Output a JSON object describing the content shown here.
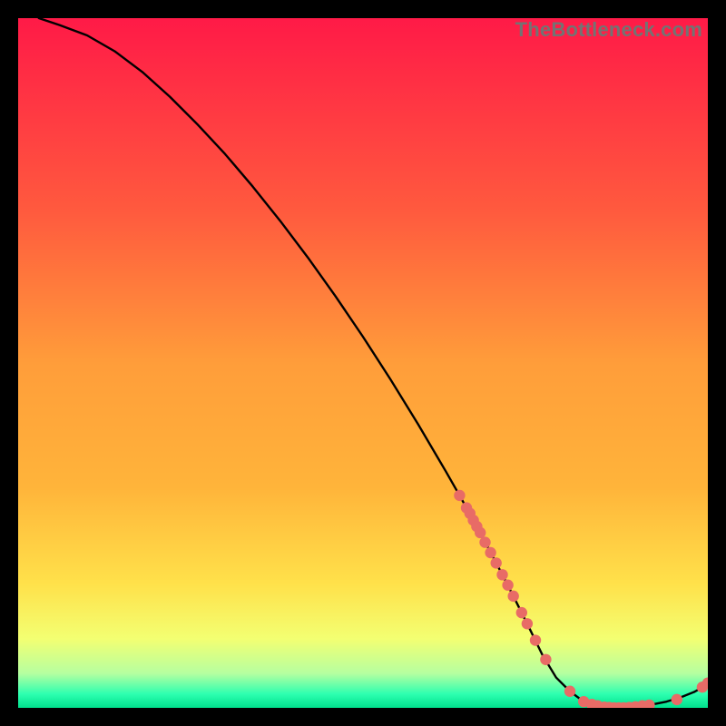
{
  "watermark": "TheBottleneck.com",
  "colors": {
    "gradient_top": "#ff1a47",
    "gradient_mid1": "#ff6a3c",
    "gradient_mid2": "#ffb43a",
    "gradient_mid3": "#ffe14a",
    "gradient_mid4": "#e7ff6a",
    "gradient_bottom_band": "#2dffb0",
    "gradient_bottom_line": "#00e08c",
    "black": "#000000",
    "line": "#000000",
    "marker": "#e86b66"
  },
  "chart_data": {
    "type": "line",
    "title": "",
    "xlabel": "",
    "ylabel": "",
    "xlim": [
      0,
      100
    ],
    "ylim": [
      0,
      100
    ],
    "series": [
      {
        "name": "curve",
        "x": [
          3,
          6,
          10,
          14,
          18,
          22,
          26,
          30,
          34,
          38,
          42,
          46,
          50,
          54,
          58,
          62,
          64,
          66,
          68,
          70,
          72,
          74,
          76,
          78,
          80,
          82,
          84,
          86,
          88,
          90,
          92,
          94,
          96,
          98,
          100
        ],
        "y": [
          100,
          99,
          97.5,
          95.2,
          92.2,
          88.6,
          84.6,
          80.3,
          75.6,
          70.6,
          65.3,
          59.7,
          53.8,
          47.6,
          41.1,
          34.3,
          30.8,
          27.2,
          23.5,
          19.7,
          15.8,
          11.8,
          7.7,
          4.4,
          2.4,
          0.9,
          0.2,
          0,
          0,
          0.2,
          0.5,
          0.9,
          1.5,
          2.3,
          3.4
        ]
      }
    ],
    "markers": [
      {
        "x": 64,
        "y": 30.8
      },
      {
        "x": 65,
        "y": 29.0
      },
      {
        "x": 65.5,
        "y": 28.2
      },
      {
        "x": 66,
        "y": 27.2
      },
      {
        "x": 66.5,
        "y": 26.3
      },
      {
        "x": 67,
        "y": 25.4
      },
      {
        "x": 67.7,
        "y": 24.0
      },
      {
        "x": 68.5,
        "y": 22.5
      },
      {
        "x": 69.3,
        "y": 21.0
      },
      {
        "x": 70.2,
        "y": 19.3
      },
      {
        "x": 71.0,
        "y": 17.8
      },
      {
        "x": 71.8,
        "y": 16.2
      },
      {
        "x": 73.0,
        "y": 13.8
      },
      {
        "x": 73.8,
        "y": 12.2
      },
      {
        "x": 75.0,
        "y": 9.8
      },
      {
        "x": 76.5,
        "y": 7.0
      },
      {
        "x": 80.0,
        "y": 2.4
      },
      {
        "x": 82.0,
        "y": 0.9
      },
      {
        "x": 83.2,
        "y": 0.5
      },
      {
        "x": 84.0,
        "y": 0.3
      },
      {
        "x": 85.0,
        "y": 0.1
      },
      {
        "x": 85.7,
        "y": 0.05
      },
      {
        "x": 86.4,
        "y": 0.0
      },
      {
        "x": 87.1,
        "y": 0.0
      },
      {
        "x": 87.8,
        "y": 0.0
      },
      {
        "x": 88.6,
        "y": 0.05
      },
      {
        "x": 89.5,
        "y": 0.15
      },
      {
        "x": 90.5,
        "y": 0.3
      },
      {
        "x": 91.5,
        "y": 0.4
      },
      {
        "x": 95.5,
        "y": 1.2
      },
      {
        "x": 99.2,
        "y": 3.0
      },
      {
        "x": 100.0,
        "y": 3.6
      }
    ]
  }
}
